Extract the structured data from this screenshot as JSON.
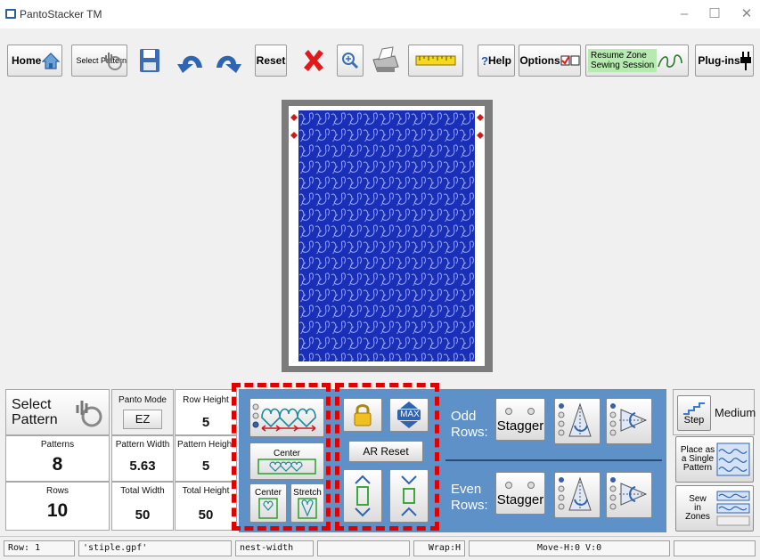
{
  "window": {
    "title": "PantoStacker TM",
    "minimize": "–",
    "maximize": "☐",
    "close": "✕"
  },
  "toolbar": {
    "home": "Home",
    "select_pattern": "Select Pattern",
    "reset": "Reset",
    "help": "Help",
    "help_prefix": "?",
    "options": "Options",
    "resume_zone": "Resume Zone",
    "resume_sewing": "Sewing Session",
    "plugins": "Plug-ins"
  },
  "left_panel": {
    "select_pattern_line1": "Select",
    "select_pattern_line2": "Pattern",
    "panto_mode_label": "Panto Mode",
    "panto_mode_value": "EZ",
    "row_height_label": "Row Height",
    "row_height_value": "5",
    "patterns_label": "Patterns",
    "patterns_value": "8",
    "pattern_width_label": "Pattern Width",
    "pattern_width_value": "5.63",
    "pattern_height_label": "Pattern Height",
    "pattern_height_value": "5",
    "rows_label": "Rows",
    "rows_value": "10",
    "total_width_label": "Total Width",
    "total_width_value": "50",
    "total_height_label": "Total Height",
    "total_height_value": "50"
  },
  "layout_controls": {
    "center_label": "Center",
    "center_small_label": "Center",
    "stretch_label": "Stretch",
    "max_label": "MAX",
    "ar_reset": "AR Reset"
  },
  "rows": {
    "odd_line1": "Odd",
    "odd_line2": "Rows:",
    "even_line1": "Even",
    "even_line2": "Rows:",
    "stagger": "Stagger"
  },
  "right_panel": {
    "step": "Step",
    "medium": "Medium",
    "place_single_1": "Place as",
    "place_single_2": "a Single",
    "place_single_3": "Pattern",
    "sew_zones_1": "Sew",
    "sew_zones_2": "in",
    "sew_zones_3": "Zones"
  },
  "status": {
    "row": "Row: 1",
    "file": "'stiple.gpf'",
    "mode": "nest-width",
    "wrap": "Wrap:H",
    "move": "Move-H:0 V:0"
  },
  "colors": {
    "pattern_blue": "#1a2fb8",
    "panel_blue": "#5e91c8",
    "highlight_red": "#e00000"
  }
}
